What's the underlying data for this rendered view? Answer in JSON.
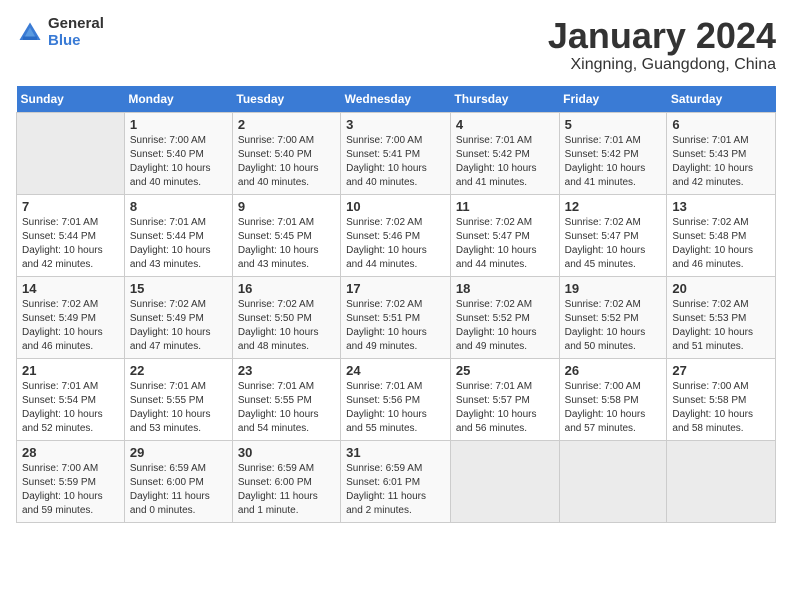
{
  "header": {
    "logo_general": "General",
    "logo_blue": "Blue",
    "month_year": "January 2024",
    "location": "Xingning, Guangdong, China"
  },
  "calendar": {
    "days_of_week": [
      "Sunday",
      "Monday",
      "Tuesday",
      "Wednesday",
      "Thursday",
      "Friday",
      "Saturday"
    ],
    "weeks": [
      [
        {
          "day": "",
          "sunrise": "",
          "sunset": "",
          "daylight": ""
        },
        {
          "day": "1",
          "sunrise": "Sunrise: 7:00 AM",
          "sunset": "Sunset: 5:40 PM",
          "daylight": "Daylight: 10 hours and 40 minutes."
        },
        {
          "day": "2",
          "sunrise": "Sunrise: 7:00 AM",
          "sunset": "Sunset: 5:40 PM",
          "daylight": "Daylight: 10 hours and 40 minutes."
        },
        {
          "day": "3",
          "sunrise": "Sunrise: 7:00 AM",
          "sunset": "Sunset: 5:41 PM",
          "daylight": "Daylight: 10 hours and 40 minutes."
        },
        {
          "day": "4",
          "sunrise": "Sunrise: 7:01 AM",
          "sunset": "Sunset: 5:42 PM",
          "daylight": "Daylight: 10 hours and 41 minutes."
        },
        {
          "day": "5",
          "sunrise": "Sunrise: 7:01 AM",
          "sunset": "Sunset: 5:42 PM",
          "daylight": "Daylight: 10 hours and 41 minutes."
        },
        {
          "day": "6",
          "sunrise": "Sunrise: 7:01 AM",
          "sunset": "Sunset: 5:43 PM",
          "daylight": "Daylight: 10 hours and 42 minutes."
        }
      ],
      [
        {
          "day": "7",
          "sunrise": "Sunrise: 7:01 AM",
          "sunset": "Sunset: 5:44 PM",
          "daylight": "Daylight: 10 hours and 42 minutes."
        },
        {
          "day": "8",
          "sunrise": "Sunrise: 7:01 AM",
          "sunset": "Sunset: 5:44 PM",
          "daylight": "Daylight: 10 hours and 43 minutes."
        },
        {
          "day": "9",
          "sunrise": "Sunrise: 7:01 AM",
          "sunset": "Sunset: 5:45 PM",
          "daylight": "Daylight: 10 hours and 43 minutes."
        },
        {
          "day": "10",
          "sunrise": "Sunrise: 7:02 AM",
          "sunset": "Sunset: 5:46 PM",
          "daylight": "Daylight: 10 hours and 44 minutes."
        },
        {
          "day": "11",
          "sunrise": "Sunrise: 7:02 AM",
          "sunset": "Sunset: 5:47 PM",
          "daylight": "Daylight: 10 hours and 44 minutes."
        },
        {
          "day": "12",
          "sunrise": "Sunrise: 7:02 AM",
          "sunset": "Sunset: 5:47 PM",
          "daylight": "Daylight: 10 hours and 45 minutes."
        },
        {
          "day": "13",
          "sunrise": "Sunrise: 7:02 AM",
          "sunset": "Sunset: 5:48 PM",
          "daylight": "Daylight: 10 hours and 46 minutes."
        }
      ],
      [
        {
          "day": "14",
          "sunrise": "Sunrise: 7:02 AM",
          "sunset": "Sunset: 5:49 PM",
          "daylight": "Daylight: 10 hours and 46 minutes."
        },
        {
          "day": "15",
          "sunrise": "Sunrise: 7:02 AM",
          "sunset": "Sunset: 5:49 PM",
          "daylight": "Daylight: 10 hours and 47 minutes."
        },
        {
          "day": "16",
          "sunrise": "Sunrise: 7:02 AM",
          "sunset": "Sunset: 5:50 PM",
          "daylight": "Daylight: 10 hours and 48 minutes."
        },
        {
          "day": "17",
          "sunrise": "Sunrise: 7:02 AM",
          "sunset": "Sunset: 5:51 PM",
          "daylight": "Daylight: 10 hours and 49 minutes."
        },
        {
          "day": "18",
          "sunrise": "Sunrise: 7:02 AM",
          "sunset": "Sunset: 5:52 PM",
          "daylight": "Daylight: 10 hours and 49 minutes."
        },
        {
          "day": "19",
          "sunrise": "Sunrise: 7:02 AM",
          "sunset": "Sunset: 5:52 PM",
          "daylight": "Daylight: 10 hours and 50 minutes."
        },
        {
          "day": "20",
          "sunrise": "Sunrise: 7:02 AM",
          "sunset": "Sunset: 5:53 PM",
          "daylight": "Daylight: 10 hours and 51 minutes."
        }
      ],
      [
        {
          "day": "21",
          "sunrise": "Sunrise: 7:01 AM",
          "sunset": "Sunset: 5:54 PM",
          "daylight": "Daylight: 10 hours and 52 minutes."
        },
        {
          "day": "22",
          "sunrise": "Sunrise: 7:01 AM",
          "sunset": "Sunset: 5:55 PM",
          "daylight": "Daylight: 10 hours and 53 minutes."
        },
        {
          "day": "23",
          "sunrise": "Sunrise: 7:01 AM",
          "sunset": "Sunset: 5:55 PM",
          "daylight": "Daylight: 10 hours and 54 minutes."
        },
        {
          "day": "24",
          "sunrise": "Sunrise: 7:01 AM",
          "sunset": "Sunset: 5:56 PM",
          "daylight": "Daylight: 10 hours and 55 minutes."
        },
        {
          "day": "25",
          "sunrise": "Sunrise: 7:01 AM",
          "sunset": "Sunset: 5:57 PM",
          "daylight": "Daylight: 10 hours and 56 minutes."
        },
        {
          "day": "26",
          "sunrise": "Sunrise: 7:00 AM",
          "sunset": "Sunset: 5:58 PM",
          "daylight": "Daylight: 10 hours and 57 minutes."
        },
        {
          "day": "27",
          "sunrise": "Sunrise: 7:00 AM",
          "sunset": "Sunset: 5:58 PM",
          "daylight": "Daylight: 10 hours and 58 minutes."
        }
      ],
      [
        {
          "day": "28",
          "sunrise": "Sunrise: 7:00 AM",
          "sunset": "Sunset: 5:59 PM",
          "daylight": "Daylight: 10 hours and 59 minutes."
        },
        {
          "day": "29",
          "sunrise": "Sunrise: 6:59 AM",
          "sunset": "Sunset: 6:00 PM",
          "daylight": "Daylight: 11 hours and 0 minutes."
        },
        {
          "day": "30",
          "sunrise": "Sunrise: 6:59 AM",
          "sunset": "Sunset: 6:00 PM",
          "daylight": "Daylight: 11 hours and 1 minute."
        },
        {
          "day": "31",
          "sunrise": "Sunrise: 6:59 AM",
          "sunset": "Sunset: 6:01 PM",
          "daylight": "Daylight: 11 hours and 2 minutes."
        },
        {
          "day": "",
          "sunrise": "",
          "sunset": "",
          "daylight": ""
        },
        {
          "day": "",
          "sunrise": "",
          "sunset": "",
          "daylight": ""
        },
        {
          "day": "",
          "sunrise": "",
          "sunset": "",
          "daylight": ""
        }
      ]
    ]
  }
}
